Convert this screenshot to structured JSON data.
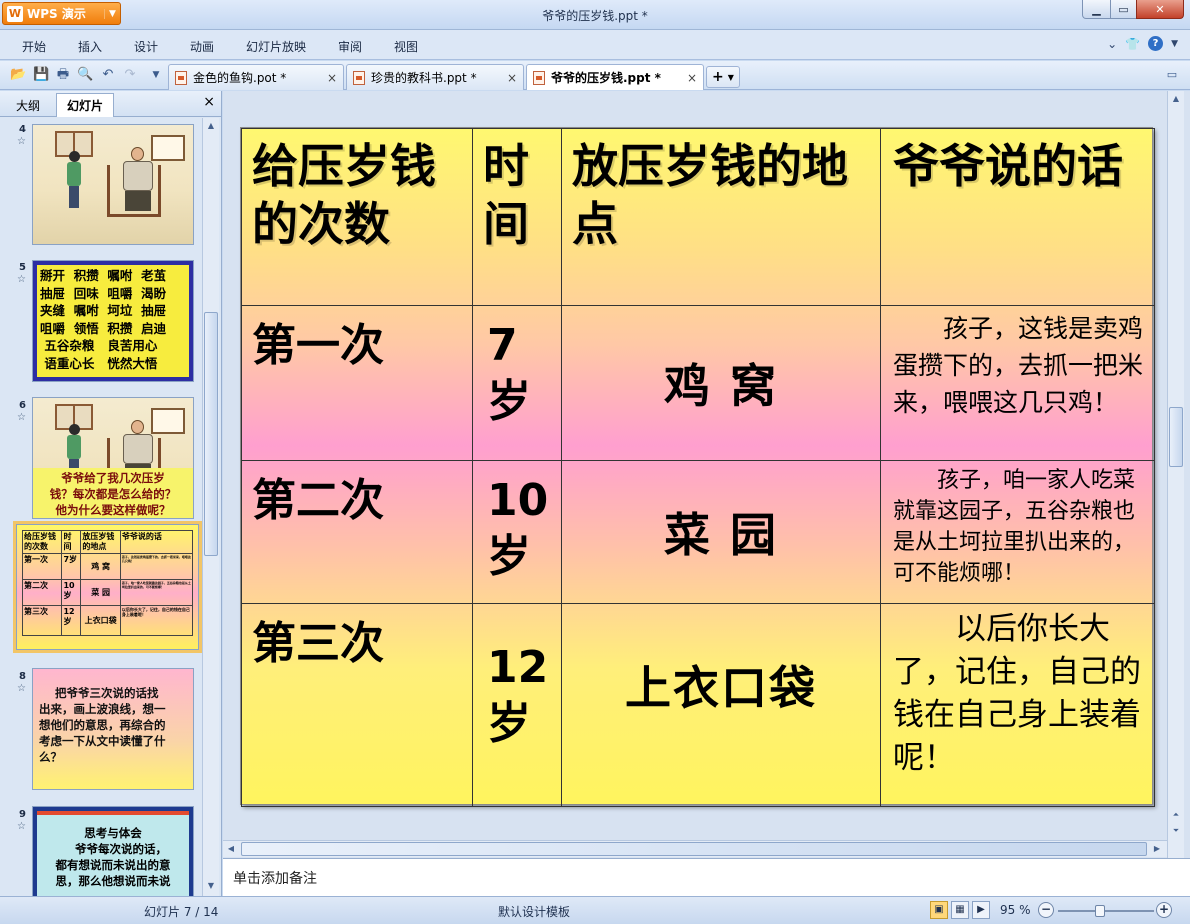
{
  "window": {
    "app_name": "WPS 演示",
    "title": "爷爷的压岁钱.ppt *"
  },
  "menu": {
    "items": [
      "开始",
      "插入",
      "设计",
      "动画",
      "幻灯片放映",
      "审阅",
      "视图"
    ]
  },
  "tabs": [
    {
      "label": "金色的鱼钩.pot *",
      "active": false
    },
    {
      "label": "珍贵的教科书.ppt *",
      "active": false
    },
    {
      "label": "爷爷的压岁钱.ppt *",
      "active": true
    }
  ],
  "left_panel": {
    "tabs": [
      "大纲",
      "幻灯片"
    ],
    "active_tab": "幻灯片",
    "thumbnails": [
      {
        "num": "4"
      },
      {
        "num": "5",
        "text": "掰开  积攒  嘱咐  老茧\n抽屉  回味  咀嚼  渴盼\n夹缝  嘱咐  坷垃  抽屉\n咀嚼  领悟  积攒  启迪\n 五谷杂粮   良苦用心\n 语重心长   恍然大悟"
      },
      {
        "num": "6",
        "text": "爷爷给了我几次压岁\n钱？每次都是怎么给的？\n他为什么要这样做呢？"
      },
      {
        "num": "7"
      },
      {
        "num": "8",
        "text": "    把爷爷三次说的话找\n出来，画上波浪线，想一\n想他们的意思，再综合的\n考虑一下从文中读懂了什\n么？"
      },
      {
        "num": "9",
        "text": "思考与体会\n    爷爷每次说的话，\n都有想说而未说出的意\n思，那么他想说而未说"
      }
    ]
  },
  "slide_table": {
    "headers": [
      "给压岁钱的次数",
      "时间",
      "放压岁钱的地点",
      "爷爷说的话"
    ],
    "rows": [
      {
        "count": "第一次",
        "age": "7岁",
        "place": "鸡  窝",
        "words": "　　孩子，这钱是卖鸡蛋攒下的，去抓一把米来，喂喂这几只鸡！"
      },
      {
        "count": "第二次",
        "age": "10岁",
        "place": "菜  园",
        "words": "　　孩子，咱一家人吃菜就靠这园子，五谷杂粮也是从土坷拉里扒出来的，可不能烦哪！"
      },
      {
        "count": "第三次",
        "age": "12岁",
        "place": "上衣口袋",
        "words": "　　以后你长大了，记住，自己的钱在自己身上装着呢！"
      }
    ]
  },
  "thumb7_table": {
    "headers": [
      "给压岁钱的次数",
      "时间",
      "放压岁钱的地点",
      "爷爷说的话"
    ],
    "rows": [
      [
        "第一次",
        "7岁",
        "鸡 窝",
        "孩子，这钱是卖鸡蛋攒下的，去抓一把米来，喂喂这几只鸡！"
      ],
      [
        "第二次",
        "10岁",
        "菜 园",
        "孩子，咱一家人吃菜就靠这园子，五谷杂粮也是从土坷拉里扒出来的，可不能烦哪！"
      ],
      [
        "第三次",
        "12岁",
        "上衣口袋",
        "以后你长大了，记住，自己的钱在自己身上装着呢！"
      ]
    ]
  },
  "notes": {
    "placeholder": "单击添加备注"
  },
  "status": {
    "slide_info": "幻灯片 7 / 14",
    "template": "默认设计模板",
    "zoom": "95 %",
    "zoom_percent": 95
  },
  "icons": [
    "app-logo-icon",
    "open-icon",
    "save-icon",
    "print-icon",
    "print-preview-icon",
    "undo-icon",
    "redo-icon",
    "dropdown-icon",
    "skin-icon",
    "help-icon"
  ],
  "colors": {
    "app_button": "#f07d0c",
    "slide_top": "#fff870",
    "slide_mid": "#ff9fcf",
    "thumb_border_selected": "#f2c566"
  }
}
